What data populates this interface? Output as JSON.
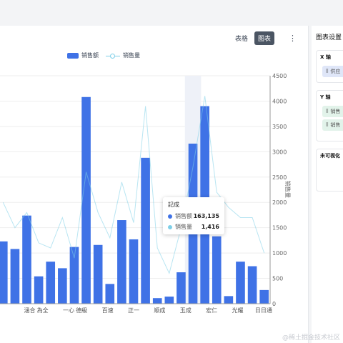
{
  "toolbar": {
    "table_tab": "表格",
    "chart_tab": "图表",
    "more_icon": "⋮"
  },
  "chart_data": {
    "type": "bar",
    "categories": [
      "",
      "",
      "涵合",
      "為全",
      "",
      "一心",
      "德級",
      "",
      "百速",
      "",
      "正一",
      "",
      "顺成",
      "",
      "玉成",
      "",
      "宏仁",
      "",
      "光耀",
      "",
      "日日通"
    ],
    "series": [
      {
        "name": "销售额",
        "type": "bar",
        "color": "#3f72e6",
        "values": [
          1230,
          1080,
          1740,
          540,
          830,
          700,
          1120,
          4080,
          1160,
          390,
          1650,
          1270,
          2880,
          110,
          140,
          620,
          3160,
          3900,
          1330,
          150,
          830,
          740,
          270
        ]
      },
      {
        "name": "销售量",
        "type": "line",
        "color": "#7ecfe8",
        "values": [
          2000,
          1500,
          1800,
          1200,
          1100,
          1700,
          900,
          2600,
          1800,
          1300,
          2400,
          1600,
          3900,
          1100,
          600,
          1500,
          2700,
          4100,
          2200,
          1900,
          1700,
          1700,
          1000
        ]
      }
    ],
    "ylabel": "销售量",
    "ylim": [
      0,
      4500
    ],
    "yticks": [
      "0",
      "500",
      "1000",
      "1500",
      "2000",
      "2500",
      "3000",
      "3500",
      "4000",
      "4500"
    ],
    "grid": true,
    "legend": "top-center"
  },
  "tooltip": {
    "title": "記成",
    "rows": [
      {
        "name": "销售额",
        "value": "163,135",
        "color": "#3f72e6"
      },
      {
        "name": "销售量",
        "value": "1,416",
        "color": "#7ecfe8"
      }
    ]
  },
  "panel": {
    "title": "图表设置",
    "x_axis": {
      "title": "X 轴",
      "chip": "⠿ 供应",
      "chip_color": "#dfe6f8"
    },
    "y_axis": {
      "title": "Y 轴",
      "chips": [
        "⠿ 销售",
        "⠿ 销售"
      ],
      "chip_color": "#e2f3ea"
    },
    "unvisualized": {
      "title": "未可视化"
    }
  },
  "watermark": "@稀土掘金技术社区"
}
